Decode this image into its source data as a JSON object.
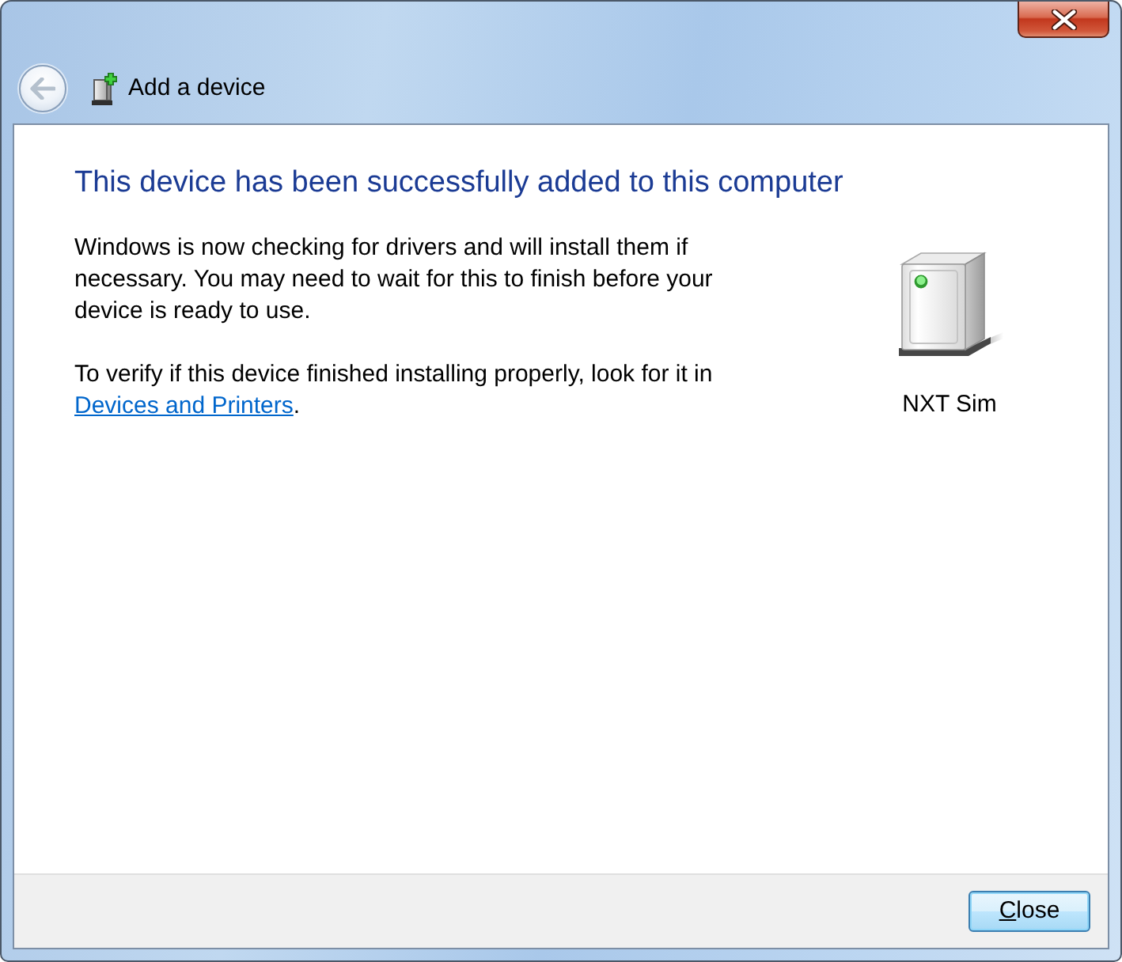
{
  "window": {
    "title": "Add a device",
    "back_button": {
      "disabled": true
    }
  },
  "content": {
    "heading": "This device has been successfully added to this computer",
    "paragraphs": [
      {
        "kind": "text",
        "text": "Windows is now checking for drivers and will install them if necessary. You may need to wait for this to finish before your device is ready to use."
      },
      {
        "kind": "link",
        "text_before": "To verify if this device finished installing properly, look for it in",
        "link": "Devices and Printers",
        "text_after": "."
      }
    ],
    "device": {
      "name": "NXT Sim"
    }
  },
  "buttons": [
    {
      "label": "Close",
      "default": true,
      "mnemonic_underlined": true
    }
  ]
}
